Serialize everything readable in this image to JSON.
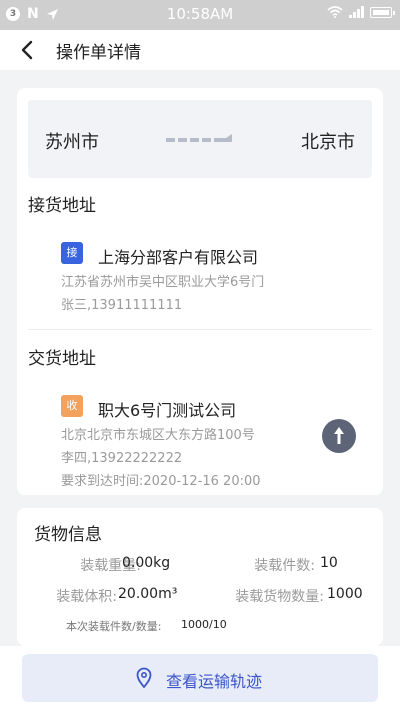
{
  "status_bar": {
    "badge": "3",
    "n_icon": "N",
    "time": "10:58AM"
  },
  "nav": {
    "title": "操作单详情"
  },
  "route": {
    "from_city": "苏州市",
    "to_city": "北京市"
  },
  "pickup": {
    "section_title": "接货地址",
    "tag": "接",
    "company": "上海分部客户有限公司",
    "address": "江苏省苏州市吴中区职业大学6号门",
    "contact": "张三,13911111111"
  },
  "delivery": {
    "section_title": "交货地址",
    "tag": "收",
    "company": "职大6号门测试公司",
    "address": "北京北京市东城区大东方路100号",
    "contact": "李四,13922222222",
    "deadline": "要求到达时间:2020-12-16 20:00"
  },
  "cargo": {
    "title": "货物信息",
    "weight_label": "装载重量:",
    "weight_value": "0.00kg",
    "pieces_label": "装载件数:",
    "pieces_value": "10",
    "volume_label": "装载体积:",
    "volume_value": "20.00m³",
    "goods_qty_label": "装载货物数量:",
    "goods_qty_value": "1000",
    "batch_label": "本次装载件数/数量:",
    "batch_value": "1000/10"
  },
  "bottom": {
    "track_button": "查看运输轨迹"
  },
  "colors": {
    "accent": "#3a63e0",
    "tag_orange": "#f2a25c",
    "button_bg": "#e8ecf9",
    "fab": "#5d6478"
  }
}
